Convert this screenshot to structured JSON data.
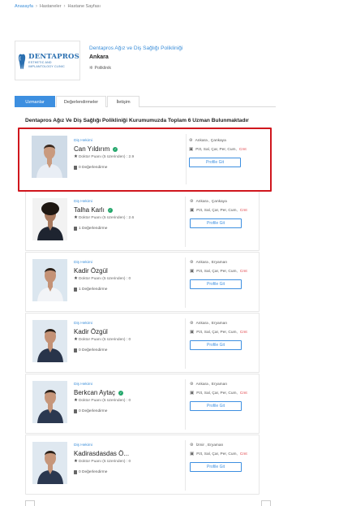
{
  "breadcrumb": {
    "home": "Anasayfa",
    "hospitals": "Hastaneler",
    "current": "Hastane Sayfası",
    "sep": "›"
  },
  "hospital": {
    "logo": {
      "title": "DENTAPROS",
      "sub1": "ESTHETIC AND",
      "sub2": "IMPLANTOLOGY CLINIC"
    },
    "name": "Dentapros Ağız ve Diş Sağlığı Polikliniği",
    "city": "Ankara",
    "type": "Poliklinik"
  },
  "tabs": [
    {
      "label": "Uzmanlar"
    },
    {
      "label": "Değerlendirmeler"
    },
    {
      "label": "İletişim"
    }
  ],
  "summary": "Dentapros Ağız Ve Diş Sağlığı Polikliniği Kurumumuzda Toplam 6 Uzman Bulunmaktadır",
  "doctors": [
    {
      "specialty": "Diş Hekimi",
      "name": "Can Yıldırım",
      "verified": true,
      "score": "Doktor Puanı (5 üzerinden) : 2.9",
      "reviews": "0 Değerlendirme",
      "location": "Ankara , Çankaya",
      "days": "Pzt, Sal, Çar, Per, Cum,",
      "closed": "Cmt",
      "button": "Profile Git"
    },
    {
      "specialty": "Diş Hekimi",
      "name": "Talha Karlı",
      "verified": true,
      "score": "Doktor Puanı (5 üzerinden) : 2.6",
      "reviews": "1 Değerlendirme",
      "location": "Ankara , Çankaya",
      "days": "Pzt, Sal, Çar, Per, Cum,",
      "closed": "Cmt",
      "button": "Profile Git"
    },
    {
      "specialty": "Diş Hekimi",
      "name": "Kadir Özgül",
      "verified": false,
      "score": "Doktor Puanı (5 üzerinden) : 0",
      "reviews": "1 Değerlendirme",
      "location": "Ankara , Eryaman",
      "days": "Pzt, Sal, Çar, Per, Cum,",
      "closed": "Cmt",
      "button": "Profile Git"
    },
    {
      "specialty": "Diş Hekimi",
      "name": "Kadir Özgül",
      "verified": false,
      "score": "Doktor Puanı (5 üzerinden) : 0",
      "reviews": "0 Değerlendirme",
      "location": "Ankara , Eryaman",
      "days": "Pzt, Sal, Çar, Per, Cum,",
      "closed": "Cmt",
      "button": "Profile Git"
    },
    {
      "specialty": "Diş Hekimi",
      "name": "Berkcan Aytaç",
      "verified": true,
      "score": "Doktor Puanı (5 üzerinden) : 0",
      "reviews": "0 Değerlendirme",
      "location": "Ankara , Eryaman",
      "days": "Pzt, Sal, Çar, Per, Cum,",
      "closed": "Cmt",
      "button": "Profile Git"
    },
    {
      "specialty": "Diş Hekimi",
      "name": "Kadirasdasdas Ö...",
      "verified": false,
      "score": "Doktor Puanı (5 üzerinden) : 0",
      "reviews": "0 Değerlendirme",
      "location": "İzmir , Eryaman",
      "days": "Pzt, Sal, Çar, Per, Cum,",
      "closed": "Cmt",
      "button": "Profile Git"
    }
  ],
  "colors": {
    "accent": "#3d8fe0",
    "highlight": "#d0161d",
    "verified": "#22a66a",
    "closed": "#e0444a"
  }
}
